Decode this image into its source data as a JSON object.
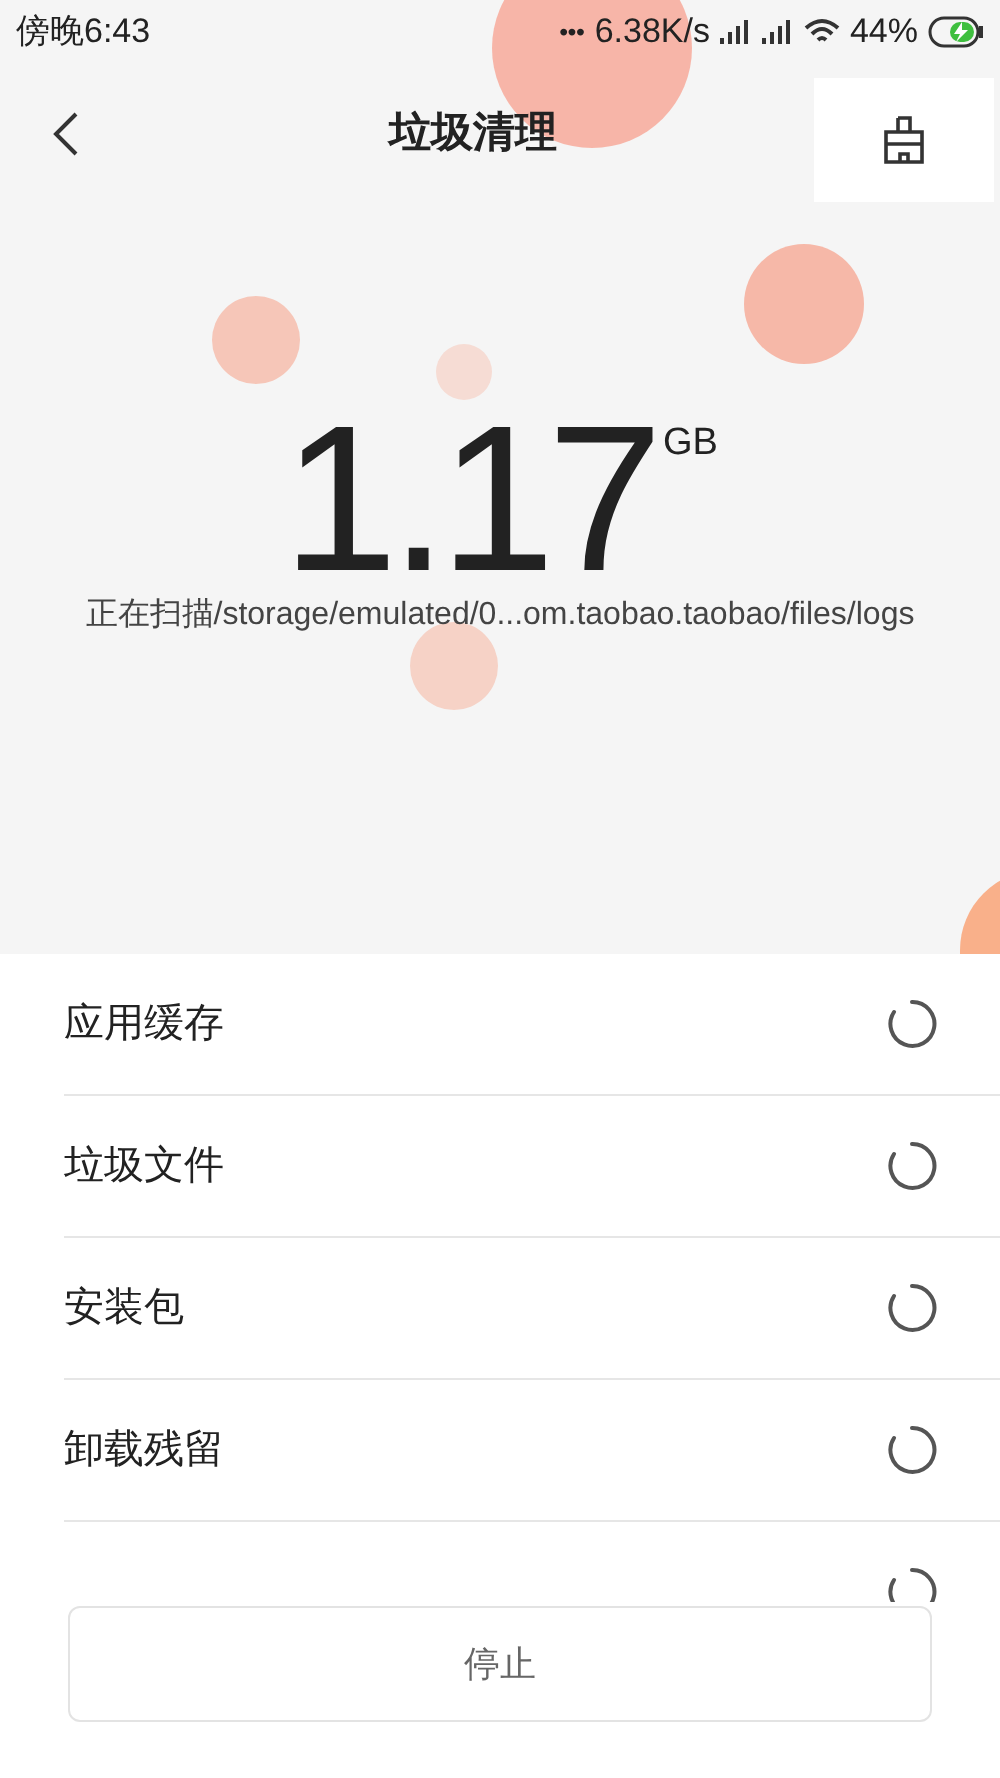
{
  "status_bar": {
    "time": "傍晚6:43",
    "more": "•••",
    "speed": "6.38K/s",
    "battery": "44%",
    "charging": true
  },
  "header": {
    "title": "垃圾清理"
  },
  "scan": {
    "size": "1.17",
    "unit": "GB",
    "path": "正在扫描/storage/emulated/0...om.taobao.taobao/files/logs"
  },
  "items": [
    {
      "label": "应用缓存",
      "scanning": true
    },
    {
      "label": "垃圾文件",
      "scanning": true
    },
    {
      "label": "安装包",
      "scanning": true
    },
    {
      "label": "卸载残留",
      "scanning": true
    },
    {
      "scanning": true
    }
  ],
  "stop_button": "停止"
}
